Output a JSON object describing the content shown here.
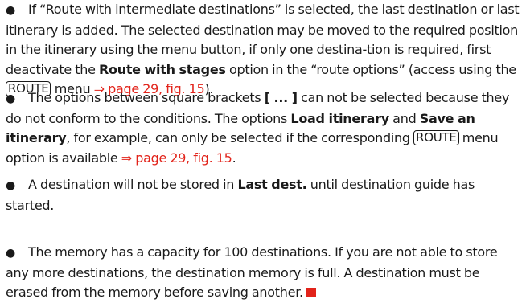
{
  "notes": [
    {
      "t1": "If “Route with intermediate destinations” is selected, the last destination or last itinerary is added. The selected destination may be moved to the required position in the itinerary using the menu button, if only one destina-tion is required, first deactivate the ",
      "b1": "Route with stages",
      "t2": " option in the “route options” (access using the ",
      "key1": "ROUTE",
      "t3": " menu ",
      "ref1": "⇒ page 29, fig. 15",
      "t4": ")."
    },
    {
      "t1": "The options between square brackets ",
      "b1": "[ ... ]",
      "t2": " can not be selected because they do not conform to the conditions. The options ",
      "b2": "Load itinerary",
      "t3": " and ",
      "b3": "Save an itinerary",
      "t4": ", for example, can only be selected if the corresponding ",
      "key1": "ROUTE",
      "t5": " menu option  is available ",
      "ref1": "⇒ page 29, fig. 15",
      "t6": "."
    },
    {
      "t1": "A destination will not be stored in ",
      "b1": "Last dest.",
      "t2": " until destination guide has started."
    },
    {
      "t1": "The memory has a capacity for 100 destinations. If you are not able to store any more destinations, the destination memory is full. A destination must be erased from the memory before saving another."
    }
  ],
  "colors": {
    "accent": "#e2231a",
    "text": "#1a1a1a"
  }
}
